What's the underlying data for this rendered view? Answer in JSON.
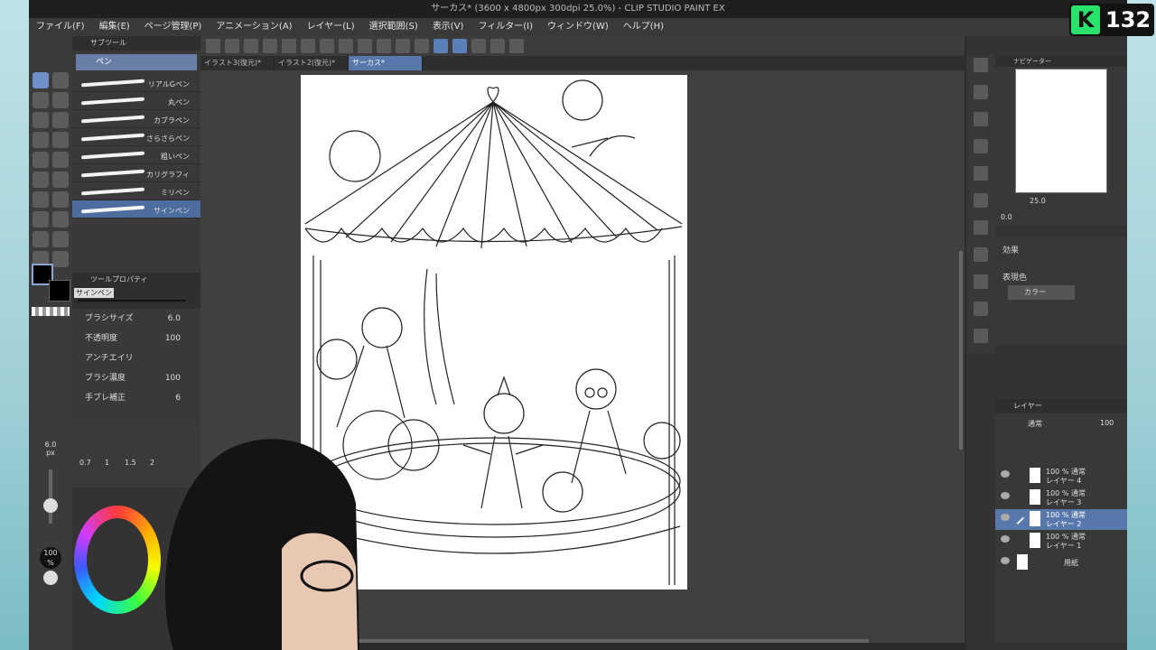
{
  "window_title": "サーカス* (3600 x 4800px 300dpi 25.0%)  - CLIP STUDIO PAINT EX",
  "menu": [
    "ファイル(F)",
    "編集(E)",
    "ページ管理(P)",
    "アニメーション(A)",
    "レイヤー(L)",
    "選択範囲(S)",
    "表示(V)",
    "フィルター(I)",
    "ウィンドウ(W)",
    "ヘルプ(H)"
  ],
  "doc_tabs": [
    "イラスト3(復元)*",
    "イラスト2(復元)*",
    "サーカス*"
  ],
  "subtool": {
    "header": "サブツール",
    "group": "ペン",
    "brushes": [
      "リアルGペン",
      "丸ペン",
      "カブラペン",
      "さらさらペン",
      "粗いペン",
      "カリグラフィ",
      "ミリペン",
      "サインペン"
    ]
  },
  "tool_property": {
    "header": "ツールプロパティ",
    "brush_name": "サインペン",
    "rows": [
      {
        "label": "ブラシサイズ",
        "value": "6.0"
      },
      {
        "label": "不透明度",
        "value": "100"
      },
      {
        "label": "アンチエイリ",
        "value": ""
      },
      {
        "label": "ブラシ濃度",
        "value": "100"
      },
      {
        "label": "手ブレ補正",
        "value": "6"
      }
    ]
  },
  "size_indicator": {
    "value": "6.0",
    "unit": "px"
  },
  "size_scale": [
    "0.7",
    "1",
    "1.5",
    "2"
  ],
  "opacity_indicator": {
    "value": "100",
    "unit": "%"
  },
  "navigator": {
    "header": "ナビゲーター",
    "zoom": "25.0",
    "rotate": "0.0"
  },
  "properties_panel": {
    "effect_label": "効果",
    "color_label": "表現色",
    "color_value": "カラー"
  },
  "layer_panel": {
    "header": "レイヤー",
    "blend": "通常",
    "opacity": "100",
    "layers": [
      {
        "pct": "100 % 通常",
        "name": "レイヤー 4"
      },
      {
        "pct": "100 % 通常",
        "name": "レイヤー 3"
      },
      {
        "pct": "100 % 通常",
        "name": "レイヤー 2"
      },
      {
        "pct": "100 % 通常",
        "name": "レイヤー 1"
      },
      {
        "pct": "",
        "name": "用紙"
      }
    ]
  },
  "badge": {
    "letter": "K",
    "number": "132"
  },
  "colors": {
    "accent": "#5878ab",
    "badge": "#29e36a"
  }
}
